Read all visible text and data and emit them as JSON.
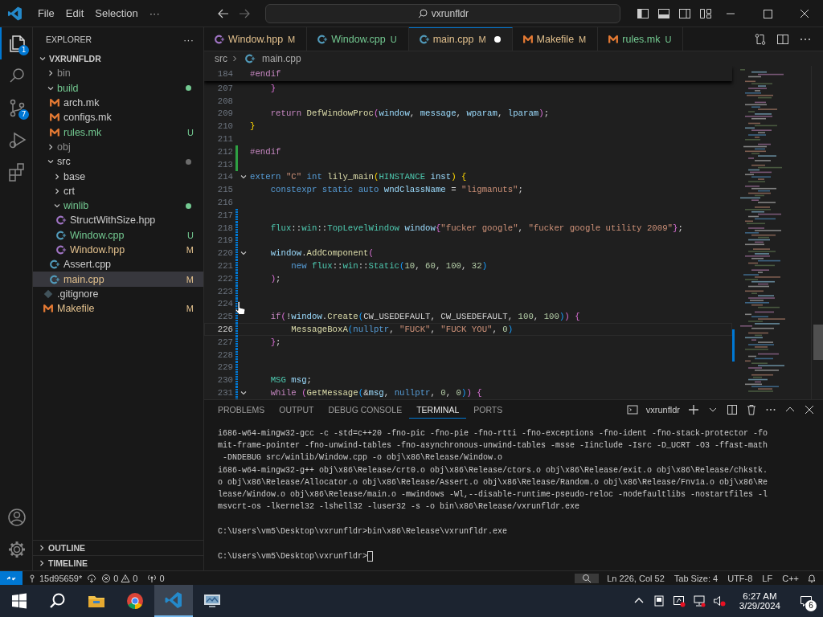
{
  "title_bar": {
    "menus": [
      "File",
      "Edit",
      "Selection",
      "···"
    ],
    "search": "vxrunfldr"
  },
  "activity_bar": {
    "top": [
      {
        "kind": "files",
        "badge": "1",
        "selected": true
      },
      {
        "kind": "search",
        "selected": false
      },
      {
        "kind": "source-control",
        "badge": "7",
        "selected": false
      },
      {
        "kind": "run",
        "selected": false
      },
      {
        "kind": "extensions",
        "selected": false
      }
    ],
    "bottom": [
      {
        "kind": "account"
      },
      {
        "kind": "settings"
      }
    ]
  },
  "sidebar": {
    "title": "EXPLORER",
    "more": "···",
    "root": "VXRUNFLDR",
    "items": [
      {
        "name": "bin",
        "kind": "folder",
        "expanded": false,
        "color": "#8c8c8c",
        "dot": false,
        "selected": false
      },
      {
        "name": "build",
        "kind": "folder",
        "expanded": true,
        "color": "#73c991",
        "dot": true,
        "selected": false,
        "children": [
          {
            "name": "arch.mk",
            "kind": "make",
            "selected": false
          },
          {
            "name": "configs.mk",
            "kind": "make",
            "selected": false
          },
          {
            "name": "rules.mk",
            "kind": "make",
            "color": "#73c991",
            "badge": "U",
            "selected": false
          }
        ]
      },
      {
        "name": "obj",
        "kind": "folder",
        "expanded": false,
        "color": "#8c8c8c",
        "dot": false,
        "selected": false
      },
      {
        "name": "src",
        "kind": "folder",
        "expanded": true,
        "dot": true,
        "selected": false,
        "children": [
          {
            "name": "base",
            "kind": "folder",
            "expanded": false,
            "dot": false,
            "selected": false
          },
          {
            "name": "crt",
            "kind": "folder",
            "expanded": false,
            "dot": false,
            "selected": false
          },
          {
            "name": "winlib",
            "kind": "folder",
            "expanded": true,
            "color": "#73c991",
            "dot": true,
            "selected": false,
            "children": [
              {
                "name": "StructWithSize.hpp",
                "kind": "hpp",
                "selected": false
              },
              {
                "name": "Window.cpp",
                "kind": "cpp",
                "color": "#73c991",
                "badge": "U",
                "selected": false
              },
              {
                "name": "Window.hpp",
                "kind": "hpp",
                "color": "#e2c08d",
                "badge": "M",
                "selected": false
              }
            ]
          },
          {
            "name": "Assert.cpp",
            "kind": "cpp",
            "selected": false
          },
          {
            "name": "main.cpp",
            "kind": "cpp",
            "color": "#e2c08d",
            "badge": "M",
            "selected": true
          }
        ]
      },
      {
        "name": ".gitignore",
        "kind": "git",
        "selected": false
      },
      {
        "name": "Makefile",
        "kind": "make",
        "color": "#e2c08d",
        "badge": "M",
        "selected": false
      }
    ],
    "sections": [
      {
        "title": "OUTLINE",
        "expanded": false
      },
      {
        "title": "TIMELINE",
        "expanded": false
      }
    ]
  },
  "tabs": [
    {
      "label": "Window.hpp",
      "kind": "hpp",
      "color": "#e2c08d",
      "badge": "M",
      "selected": false,
      "dirty": false
    },
    {
      "label": "Window.cpp",
      "kind": "cpp",
      "color": "#73c991",
      "badge": "U",
      "selected": false,
      "dirty": false
    },
    {
      "label": "main.cpp",
      "kind": "cpp",
      "color": "#e2c08d",
      "badge": "M",
      "selected": true,
      "dirty": true
    },
    {
      "label": "Makefile",
      "kind": "make",
      "color": "#e2c08d",
      "badge": "M",
      "selected": false,
      "dirty": false
    },
    {
      "label": "rules.mk",
      "kind": "make",
      "color": "#73c991",
      "badge": "U",
      "selected": false,
      "dirty": false
    }
  ],
  "breadcrumb": [
    {
      "label": "src",
      "kind": "folder"
    },
    {
      "label": "main.cpp",
      "kind": "cpp"
    }
  ],
  "editor": {
    "sticky": {
      "number": "184",
      "fold": false,
      "current": false,
      "tokens": [
        {
          "text": "#endif",
          "kind": "ctrl"
        }
      ]
    },
    "lines": [
      {
        "number": "207",
        "fold": false,
        "current": false,
        "tokens": [
          {
            "text": "    }",
            "kind": "b2"
          }
        ]
      },
      {
        "number": "208",
        "fold": false,
        "current": false
      },
      {
        "number": "209",
        "fold": false,
        "current": false,
        "tokens": [
          {
            "text": "    return ",
            "kind": "ctrl"
          },
          {
            "text": "DefWindowProc",
            "kind": "fn"
          },
          {
            "text": "(",
            "kind": "b2"
          },
          {
            "text": "window",
            "kind": "var"
          },
          {
            "text": ", ",
            "kind": "plain"
          },
          {
            "text": "message",
            "kind": "var"
          },
          {
            "text": ", ",
            "kind": "plain"
          },
          {
            "text": "wparam",
            "kind": "var"
          },
          {
            "text": ", ",
            "kind": "plain"
          },
          {
            "text": "lparam",
            "kind": "var"
          },
          {
            "text": ")",
            "kind": "b2"
          },
          {
            "text": ";",
            "kind": "plain"
          }
        ]
      },
      {
        "number": "210",
        "fold": false,
        "current": false,
        "tokens": [
          {
            "text": "}",
            "kind": "b1"
          }
        ]
      },
      {
        "number": "211",
        "fold": false,
        "current": false
      },
      {
        "number": "212",
        "fold": false,
        "current": false,
        "kind": "added",
        "tokens": [
          {
            "text": "#endif",
            "kind": "ctrl"
          }
        ]
      },
      {
        "number": "213",
        "fold": false,
        "current": false,
        "kind": "added"
      },
      {
        "number": "214",
        "fold": true,
        "current": false,
        "tokens": [
          {
            "text": "extern ",
            "kind": "kw"
          },
          {
            "text": "\"C\" ",
            "kind": "str"
          },
          {
            "text": "int ",
            "kind": "kw"
          },
          {
            "text": "lily_main",
            "kind": "fn"
          },
          {
            "text": "(",
            "kind": "b1"
          },
          {
            "text": "HINSTANCE ",
            "kind": "type"
          },
          {
            "text": "inst",
            "kind": "var"
          },
          {
            "text": ") {",
            "kind": "b1"
          }
        ]
      },
      {
        "number": "215",
        "fold": false,
        "current": false,
        "tokens": [
          {
            "text": "    constexpr static auto ",
            "kind": "kw"
          },
          {
            "text": "wndClassName",
            "kind": "var"
          },
          {
            "text": " = ",
            "kind": "plain"
          },
          {
            "text": "\"ligmanuts\"",
            "kind": "str"
          },
          {
            "text": ";",
            "kind": "plain"
          }
        ]
      },
      {
        "number": "216",
        "fold": false,
        "current": false
      },
      {
        "number": "217",
        "fold": false,
        "current": false,
        "kind": "modified"
      },
      {
        "number": "218",
        "fold": false,
        "current": false,
        "kind": "modified",
        "tokens": [
          {
            "text": "    flux",
            "kind": "type"
          },
          {
            "text": "::",
            "kind": "plain"
          },
          {
            "text": "win",
            "kind": "type"
          },
          {
            "text": "::",
            "kind": "plain"
          },
          {
            "text": "TopLevelWindow ",
            "kind": "type"
          },
          {
            "text": "window",
            "kind": "var"
          },
          {
            "text": "{",
            "kind": "b2"
          },
          {
            "text": "\"fucker google\"",
            "kind": "str"
          },
          {
            "text": ", ",
            "kind": "plain"
          },
          {
            "text": "\"fucker google utility 2009\"",
            "kind": "str"
          },
          {
            "text": "}",
            "kind": "b2"
          },
          {
            "text": ";",
            "kind": "plain"
          }
        ]
      },
      {
        "number": "219",
        "fold": false,
        "current": false,
        "kind": "modified"
      },
      {
        "number": "220",
        "fold": true,
        "current": false,
        "kind": "modified",
        "tokens": [
          {
            "text": "    window",
            "kind": "var"
          },
          {
            "text": ".",
            "kind": "plain"
          },
          {
            "text": "AddComponent",
            "kind": "fn"
          },
          {
            "text": "(",
            "kind": "b2"
          }
        ]
      },
      {
        "number": "221",
        "fold": false,
        "current": false,
        "kind": "modified",
        "tokens": [
          {
            "text": "        new ",
            "kind": "kw"
          },
          {
            "text": "flux",
            "kind": "type"
          },
          {
            "text": "::",
            "kind": "plain"
          },
          {
            "text": "win",
            "kind": "type"
          },
          {
            "text": "::",
            "kind": "plain"
          },
          {
            "text": "Static",
            "kind": "type"
          },
          {
            "text": "(",
            "kind": "b3"
          },
          {
            "text": "10",
            "kind": "num"
          },
          {
            "text": ", ",
            "kind": "plain"
          },
          {
            "text": "60",
            "kind": "num"
          },
          {
            "text": ", ",
            "kind": "plain"
          },
          {
            "text": "100",
            "kind": "num"
          },
          {
            "text": ", ",
            "kind": "plain"
          },
          {
            "text": "32",
            "kind": "num"
          },
          {
            "text": ")",
            "kind": "b3"
          }
        ]
      },
      {
        "number": "222",
        "fold": false,
        "current": false,
        "kind": "modified",
        "tokens": [
          {
            "text": "    )",
            "kind": "b2"
          },
          {
            "text": ";",
            "kind": "plain"
          }
        ]
      },
      {
        "number": "223",
        "fold": false,
        "current": false,
        "kind": "modified"
      },
      {
        "number": "224",
        "fold": false,
        "current": false,
        "kind": "modified"
      },
      {
        "number": "225",
        "fold": false,
        "current": false,
        "kind": "modified",
        "tokens": [
          {
            "text": "    if",
            "kind": "ctrl"
          },
          {
            "text": "(",
            "kind": "b2"
          },
          {
            "text": "!",
            "kind": "plain"
          },
          {
            "text": "window",
            "kind": "var"
          },
          {
            "text": ".",
            "kind": "plain"
          },
          {
            "text": "Create",
            "kind": "fn"
          },
          {
            "text": "(",
            "kind": "b3"
          },
          {
            "text": "CW_USEDEFAULT, CW_USEDEFAULT, ",
            "kind": "plain"
          },
          {
            "text": "100",
            "kind": "num"
          },
          {
            "text": ", ",
            "kind": "plain"
          },
          {
            "text": "100",
            "kind": "num"
          },
          {
            "text": ")",
            "kind": "b3"
          },
          {
            "text": ") {",
            "kind": "b2"
          }
        ]
      },
      {
        "number": "226",
        "fold": false,
        "current": true,
        "kind": "modified",
        "tokens": [
          {
            "text": "        MessageBoxA",
            "kind": "fn"
          },
          {
            "text": "(",
            "kind": "b3"
          },
          {
            "text": "nullptr",
            "kind": "kw"
          },
          {
            "text": ", ",
            "kind": "plain"
          },
          {
            "text": "\"FUCK\"",
            "kind": "str"
          },
          {
            "text": ", ",
            "kind": "plain"
          },
          {
            "text": "\"FUCK YOU\"",
            "kind": "str"
          },
          {
            "text": ", ",
            "kind": "plain"
          },
          {
            "text": "0",
            "kind": "num"
          },
          {
            "text": ")",
            "kind": "b3"
          }
        ]
      },
      {
        "number": "227",
        "fold": false,
        "current": false,
        "kind": "modified",
        "tokens": [
          {
            "text": "    }",
            "kind": "b2"
          },
          {
            "text": ";",
            "kind": "plain"
          }
        ]
      },
      {
        "number": "228",
        "fold": false,
        "current": false,
        "kind": "modified"
      },
      {
        "number": "229",
        "fold": false,
        "current": false,
        "kind": "modified"
      },
      {
        "number": "230",
        "fold": false,
        "current": false,
        "kind": "modified",
        "tokens": [
          {
            "text": "    MSG ",
            "kind": "type"
          },
          {
            "text": "msg",
            "kind": "var"
          },
          {
            "text": ";",
            "kind": "plain"
          }
        ]
      },
      {
        "number": "231",
        "fold": true,
        "current": false,
        "kind": "modified",
        "tokens": [
          {
            "text": "    while ",
            "kind": "ctrl"
          },
          {
            "text": "(",
            "kind": "b2"
          },
          {
            "text": "GetMessage",
            "kind": "fn"
          },
          {
            "text": "(",
            "kind": "b3"
          },
          {
            "text": "&",
            "kind": "plain"
          },
          {
            "text": "msg",
            "kind": "var"
          },
          {
            "text": ", ",
            "kind": "plain"
          },
          {
            "text": "nullptr",
            "kind": "kw"
          },
          {
            "text": ", ",
            "kind": "plain"
          },
          {
            "text": "0",
            "kind": "num"
          },
          {
            "text": ", ",
            "kind": "plain"
          },
          {
            "text": "0",
            "kind": "num"
          },
          {
            "text": ")",
            "kind": "b3"
          },
          {
            "text": ") {",
            "kind": "b2"
          }
        ]
      }
    ]
  },
  "panel": {
    "tabs": [
      {
        "label": "PROBLEMS",
        "selected": false
      },
      {
        "label": "OUTPUT",
        "selected": false
      },
      {
        "label": "DEBUG CONSOLE",
        "selected": false
      },
      {
        "label": "TERMINAL",
        "selected": true
      },
      {
        "label": "PORTS",
        "selected": false
      }
    ],
    "terminal_name": "vxrunfldr",
    "output": [
      [
        "i686-w64-mingw32-gcc -c -std=c++20 -fno-pic -fno-pie -fno-rtti -fno-exceptions -fno-ident -fno-stack-protector -fo",
        "mit-frame-pointer -fno-unwind-tables -fno-asynchronous-unwind-tables -msse -Iinclude -Isrc -D_UCRT -O3 -ffast-math",
        " -DNDEBUG src/winlib/Window.cpp -o obj\\x86\\Release/Window.o",
        "i686-w64-mingw32-g++ obj\\x86\\Release/crt0.o obj\\x86\\Release/ctors.o obj\\x86\\Release/exit.o obj\\x86\\Release/chkstk.",
        "o obj\\x86\\Release/Allocator.o obj\\x86\\Release/Assert.o obj\\x86\\Release/Random.o obj\\x86\\Release/Fnv1a.o obj\\x86\\Re",
        "lease/Window.o obj\\x86\\Release/main.o -mwindows -Wl,--disable-runtime-pseudo-reloc -nodefaultlibs -nostartfiles -l",
        "msvcrt-os -lkernel32 -lshell32 -luser32 -s -o bin\\x86\\Release/vxrunfldr.exe"
      ],
      [
        "C:\\Users\\vm5\\Desktop\\vxrunfldr>bin\\x86\\Release\\vxrunfldr.exe"
      ],
      [
        "C:\\Users\\vm5\\Desktop\\vxrunfldr>"
      ]
    ]
  },
  "status_bar": {
    "branch": "15d95659*",
    "errors": "0",
    "warnings": "0",
    "ports": "0",
    "right": [
      "Ln 226, Col 52",
      "Tab Size: 4",
      "UTF-8",
      "LF",
      "C++"
    ]
  },
  "taskbar": {
    "apps": [
      {
        "kind": "folder",
        "selected": false
      },
      {
        "kind": "browser",
        "selected": false
      },
      {
        "kind": "editor",
        "selected": true
      },
      {
        "kind": "monitor",
        "selected": false
      }
    ],
    "time": "6:27 AM",
    "date": "3/29/2024",
    "notifications": "6"
  }
}
